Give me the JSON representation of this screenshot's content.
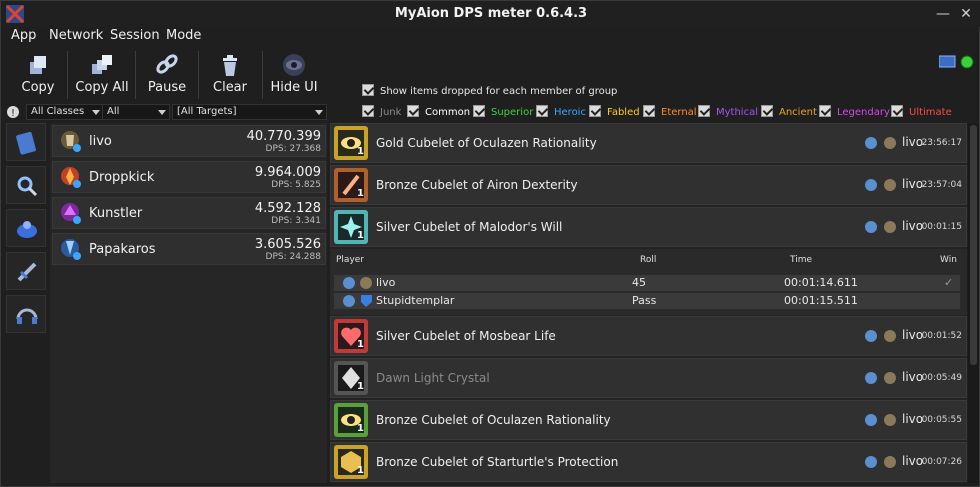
{
  "window": {
    "title": "MyAion DPS meter 0.6.4.3",
    "minimize": "—",
    "close": "✕"
  },
  "menu": [
    "App",
    "Network",
    "Session",
    "Mode"
  ],
  "toolbar": [
    {
      "label": "Copy",
      "icon": "copy-icon"
    },
    {
      "label": "Copy All",
      "icon": "copy-all-icon"
    },
    {
      "label": "Pause",
      "icon": "pause-icon"
    },
    {
      "label": "Clear",
      "icon": "clear-icon"
    },
    {
      "label": "Hide UI",
      "icon": "hide-ui-icon"
    }
  ],
  "show_dropped": "Show items dropped for each member of group",
  "filters": {
    "classes": "All Classes",
    "type": "All",
    "targets": "[All Targets]"
  },
  "rarities": [
    {
      "label": "Junk",
      "color": "#8a8a8a"
    },
    {
      "label": "Common",
      "color": "#ffffff"
    },
    {
      "label": "Superior",
      "color": "#3fd43f"
    },
    {
      "label": "Heroic",
      "color": "#3aa6ff"
    },
    {
      "label": "Fabled",
      "color": "#ffcc22"
    },
    {
      "label": "Eternal",
      "color": "#ff8a2a"
    },
    {
      "label": "Mythical",
      "color": "#a855f7"
    },
    {
      "label": "Ancient",
      "color": "#e8a72a"
    },
    {
      "label": "Legendary",
      "color": "#d946ef"
    },
    {
      "label": "Ultimate",
      "color": "#ff4a4a"
    }
  ],
  "players": [
    {
      "name": "livo",
      "damage": "40.770.399",
      "dps": "DPS: 27.368"
    },
    {
      "name": "Droppkick",
      "damage": "9.964.009",
      "dps": "DPS: 5.825"
    },
    {
      "name": "Kunstler",
      "damage": "4.592.128",
      "dps": "DPS: 3.341"
    },
    {
      "name": "Papakaros",
      "damage": "3.605.526",
      "dps": "DPS: 24.288"
    }
  ],
  "items": [
    {
      "name": "Gold Cubelet of Oculazen Rationality",
      "qty": "1",
      "winner": "livo",
      "time": "23:56:17",
      "color": "#c9a227"
    },
    {
      "name": "Bronze Cubelet of Airon Dexterity",
      "qty": "1",
      "winner": "livo",
      "time": "23:57:04",
      "color": "#b0602a"
    },
    {
      "name": "Silver Cubelet of Malodor's Will",
      "qty": "1",
      "winner": "livo",
      "time": "00:01:15",
      "color": "#4fb5b5"
    },
    {
      "name": "Silver Cubelet of Mosbear Life",
      "qty": "1",
      "winner": "livo",
      "time": "00:01:52",
      "color": "#c03a3a"
    },
    {
      "name": "Dawn Light Crystal",
      "qty": "1",
      "winner": "livo",
      "time": "00:05:49",
      "color": "#777777"
    },
    {
      "name": "Bronze Cubelet of Oculazen Rationality",
      "qty": "1",
      "winner": "livo",
      "time": "00:05:55",
      "color": "#5aa03a"
    },
    {
      "name": "Bronze Cubelet of Starturtle's Protection",
      "qty": "1",
      "winner": "livo",
      "time": "00:07:26",
      "color": "#c9a227"
    }
  ],
  "roll_table": {
    "headers": {
      "player": "Player",
      "roll": "Roll",
      "time": "Time",
      "win": "Win"
    },
    "rows": [
      {
        "player": "livo",
        "roll": "45",
        "time": "00:01:14.611",
        "win": "✓"
      },
      {
        "player": "Stupidtemplar",
        "roll": "Pass",
        "time": "00:01:15.511",
        "win": ""
      }
    ]
  }
}
